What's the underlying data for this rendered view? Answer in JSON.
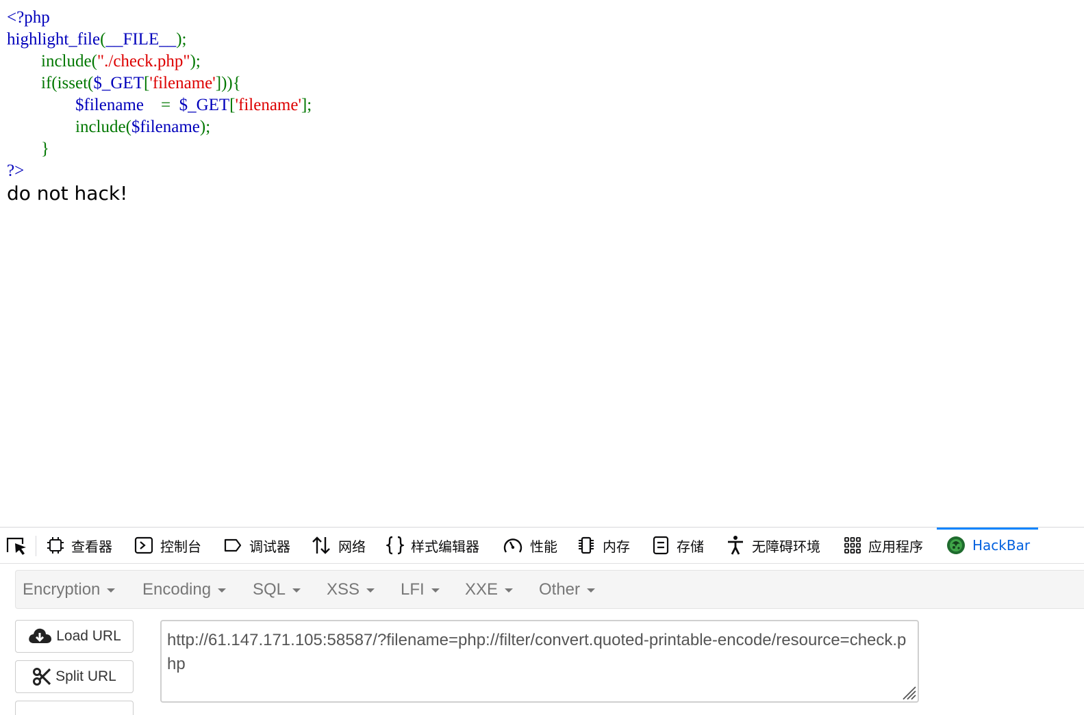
{
  "source": {
    "lines": [
      [
        {
          "t": "<?php",
          "c": "def"
        }
      ],
      [
        {
          "t": "highlight_file",
          "c": "def"
        },
        {
          "t": "(",
          "c": "kw"
        },
        {
          "t": "__FILE__",
          "c": "def"
        },
        {
          "t": ");",
          "c": "kw"
        }
      ],
      [
        {
          "t": "        ",
          "c": "def"
        },
        {
          "t": "include(",
          "c": "kw"
        },
        {
          "t": "\"./check.php\"",
          "c": "str"
        },
        {
          "t": ");",
          "c": "kw"
        }
      ],
      [
        {
          "t": "        ",
          "c": "def"
        },
        {
          "t": "if(isset(",
          "c": "kw"
        },
        {
          "t": "$_GET",
          "c": "def"
        },
        {
          "t": "[",
          "c": "kw"
        },
        {
          "t": "'filename'",
          "c": "str"
        },
        {
          "t": "])){",
          "c": "kw"
        }
      ],
      [
        {
          "t": "                ",
          "c": "def"
        },
        {
          "t": "$filename    ",
          "c": "def"
        },
        {
          "t": "=  ",
          "c": "kw"
        },
        {
          "t": "$_GET",
          "c": "def"
        },
        {
          "t": "[",
          "c": "kw"
        },
        {
          "t": "'filename'",
          "c": "str"
        },
        {
          "t": "];",
          "c": "kw"
        }
      ],
      [
        {
          "t": "                ",
          "c": "def"
        },
        {
          "t": "include(",
          "c": "kw"
        },
        {
          "t": "$filename",
          "c": "def"
        },
        {
          "t": ");",
          "c": "kw"
        }
      ],
      [
        {
          "t": "        ",
          "c": "def"
        },
        {
          "t": "}",
          "c": "kw"
        }
      ],
      [
        {
          "t": "?>",
          "c": "def"
        }
      ]
    ]
  },
  "output_text": "do not hack!",
  "devtools": {
    "tabs": [
      {
        "label": "查看器",
        "icon": "inspector-icon"
      },
      {
        "label": "控制台",
        "icon": "console-icon"
      },
      {
        "label": "调试器",
        "icon": "debugger-icon"
      },
      {
        "label": "网络",
        "icon": "network-icon"
      },
      {
        "label": "样式编辑器",
        "icon": "style-editor-icon"
      },
      {
        "label": "性能",
        "icon": "performance-icon"
      },
      {
        "label": "内存",
        "icon": "memory-icon"
      },
      {
        "label": "存储",
        "icon": "storage-icon"
      },
      {
        "label": "无障碍环境",
        "icon": "accessibility-icon"
      },
      {
        "label": "应用程序",
        "icon": "application-icon"
      },
      {
        "label": "HackBar",
        "icon": "hackbar-icon",
        "active": true
      }
    ]
  },
  "hackbar": {
    "menus": [
      "Encryption",
      "Encoding",
      "SQL",
      "XSS",
      "LFI",
      "XXE",
      "Other"
    ],
    "buttons": {
      "load_url": "Load URL",
      "split_url": "Split URL"
    },
    "url_value": "http://61.147.171.105:58587/?filename=php://filter/convert.quoted-printable-encode/resource=check.php"
  },
  "colors": {
    "php_default": "#0000BB",
    "php_keyword": "#007700",
    "php_string": "#DD0000",
    "active_tab": "#0060df",
    "tab_indicator": "#0a84ff",
    "menu_text": "#777777"
  }
}
